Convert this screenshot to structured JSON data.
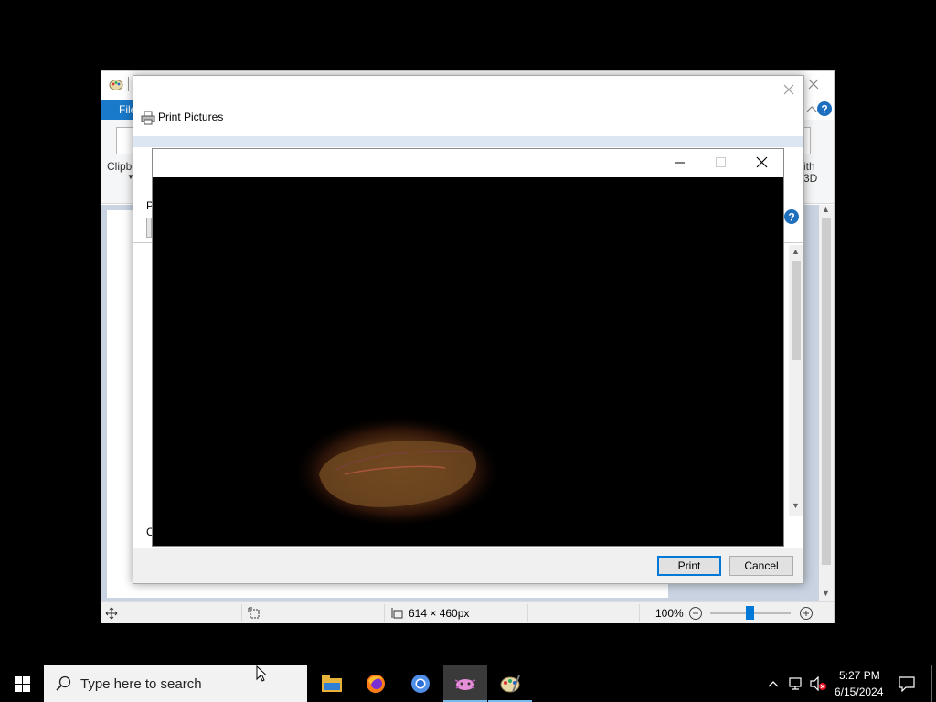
{
  "paint": {
    "file_tab": "File",
    "clipboard_label": "Clipbo",
    "edit3d_label_line1": "ith",
    "edit3d_label_line2": "3D",
    "status": {
      "image_size": "614 × 460px",
      "zoom": "100%"
    }
  },
  "print_dialog": {
    "title": "Print Pictures",
    "side_label_top": "P",
    "side_label_bottom": "C",
    "print_button": "Print",
    "cancel_button": "Cancel"
  },
  "taskbar": {
    "search_placeholder": "Type here to search",
    "clock_time": "5:27 PM",
    "clock_date": "6/15/2024",
    "apps": [
      "file-explorer-icon",
      "firefox-icon",
      "chromium-icon",
      "image-viewer-icon",
      "paint-icon"
    ]
  },
  "colors": {
    "accent": "#0078d7",
    "ribbon_file_tab": "#1979ca",
    "help": "#1f6fbf"
  }
}
